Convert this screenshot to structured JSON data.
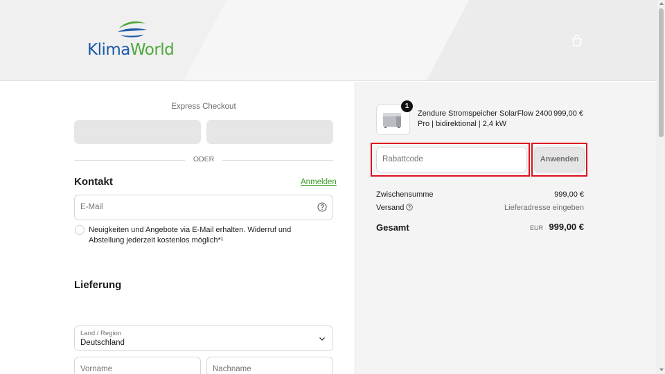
{
  "header": {
    "logo_text_a": "Klima",
    "logo_text_b": "World",
    "cart_icon": "shopping-bag-icon"
  },
  "express": {
    "label": "Express Checkout",
    "divider": "ODER"
  },
  "contact": {
    "title": "Kontakt",
    "login_link": "Anmelden",
    "email_placeholder": "E-Mail",
    "newsletter_text": "Neuigkeiten und Angebote via E-Mail erhalten. Widerruf und Abstellung jederzeit kostenlos möglich*¹"
  },
  "delivery": {
    "title": "Lieferung",
    "country_label": "Land / Region",
    "country_value": "Deutschland",
    "firstname_placeholder": "Vorname",
    "lastname_placeholder": "Nachname"
  },
  "summary": {
    "item": {
      "quantity": "1",
      "name": "Zendure Stromspeicher SolarFlow 2400 Pro | bidirektional | 2,4 kW",
      "price": "999,00 €"
    },
    "discount_placeholder": "Rabattcode",
    "apply_label": "Anwenden",
    "subtotal_label": "Zwischensumme",
    "subtotal_value": "999,00 €",
    "shipping_label": "Versand",
    "shipping_value": "Lieferadresse eingeben",
    "total_label": "Gesamt",
    "total_currency": "EUR",
    "total_value": "999,00 €"
  },
  "colors": {
    "logo_blue": "#1d5aa8",
    "logo_green": "#4fa83d",
    "link_green": "#3c9d2a",
    "highlight_red": "#e0101e"
  }
}
